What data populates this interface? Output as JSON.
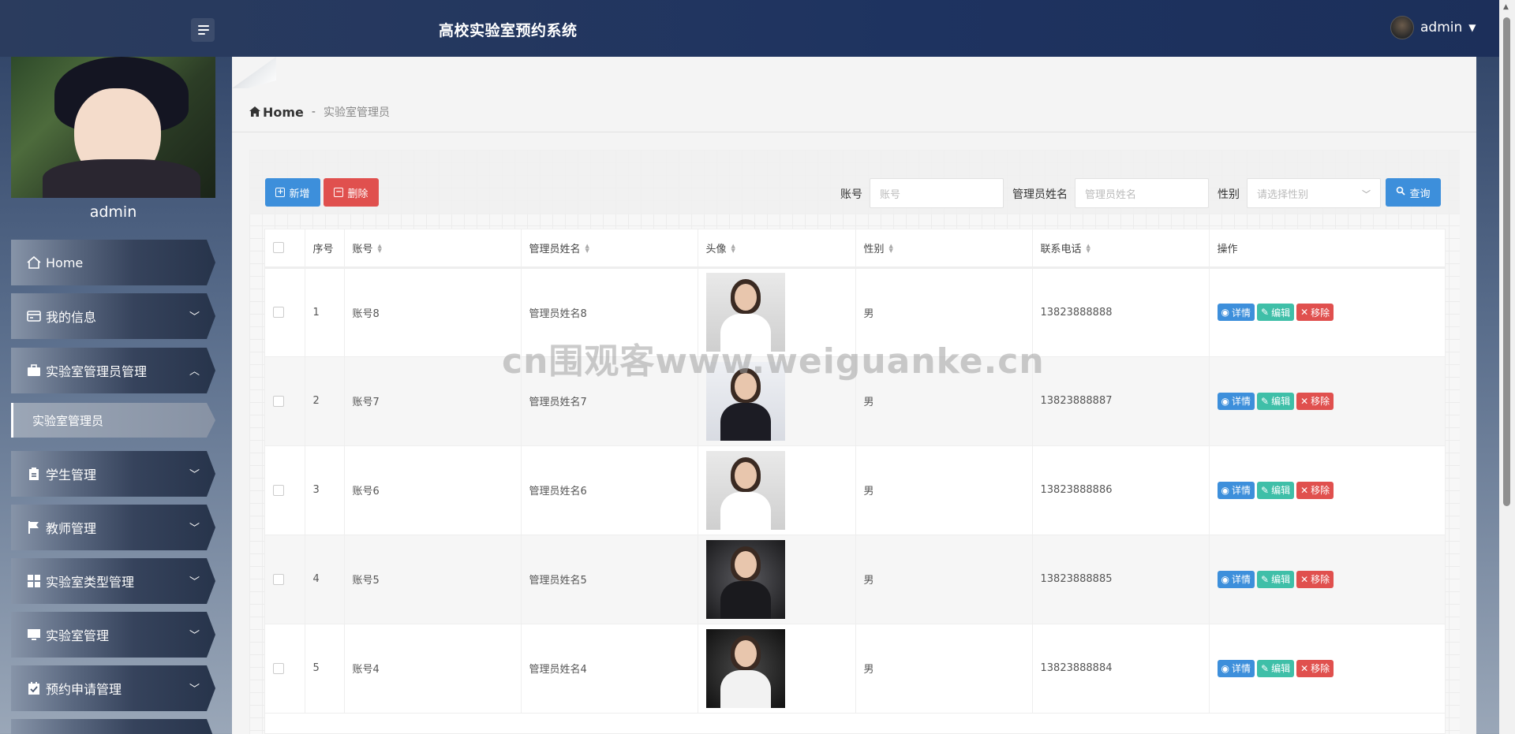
{
  "header": {
    "title": "高校实验室预约系统",
    "user": "admin"
  },
  "sidebar": {
    "profile_name": "admin",
    "items": [
      {
        "label": "Home",
        "icon": "home-icon"
      },
      {
        "label": "我的信息",
        "icon": "card-icon"
      },
      {
        "label": "实验室管理员管理",
        "icon": "briefcase-icon",
        "expanded": true
      },
      {
        "label": "学生管理",
        "icon": "clipboard-icon"
      },
      {
        "label": "教师管理",
        "icon": "flag-icon"
      },
      {
        "label": "实验室类型管理",
        "icon": "grid-icon"
      },
      {
        "label": "实验室管理",
        "icon": "monitor-icon"
      },
      {
        "label": "预约申请管理",
        "icon": "calendar-check-icon"
      }
    ],
    "active_sub": "实验室管理员"
  },
  "breadcrumb": {
    "home": "Home",
    "separator": "-",
    "current": "实验室管理员"
  },
  "toolbar": {
    "add_label": "新增",
    "delete_label": "删除",
    "search_label": "查询",
    "filters": [
      {
        "label": "账号",
        "placeholder": "账号"
      },
      {
        "label": "管理员姓名",
        "placeholder": "管理员姓名"
      },
      {
        "label": "性别",
        "placeholder": "请选择性别"
      }
    ]
  },
  "table": {
    "columns": [
      "序号",
      "账号",
      "管理员姓名",
      "头像",
      "性别",
      "联系电话",
      "操作"
    ],
    "rows": [
      {
        "no": "1",
        "account": "账号8",
        "name": "管理员姓名8",
        "gender": "男",
        "phone": "13823888888"
      },
      {
        "no": "2",
        "account": "账号7",
        "name": "管理员姓名7",
        "gender": "男",
        "phone": "13823888887"
      },
      {
        "no": "3",
        "account": "账号6",
        "name": "管理员姓名6",
        "gender": "男",
        "phone": "13823888886"
      },
      {
        "no": "4",
        "account": "账号5",
        "name": "管理员姓名5",
        "gender": "男",
        "phone": "13823888885"
      },
      {
        "no": "5",
        "account": "账号4",
        "name": "管理员姓名4",
        "gender": "男",
        "phone": "13823888884"
      }
    ],
    "actions": {
      "detail": "详情",
      "edit": "编辑",
      "remove": "移除"
    }
  },
  "watermark": "cn围观客www.weiguanke.cn",
  "colors": {
    "primary": "#3d8fdb",
    "danger": "#e0504e",
    "success": "#3fbfa8",
    "header": "#1e3360"
  }
}
